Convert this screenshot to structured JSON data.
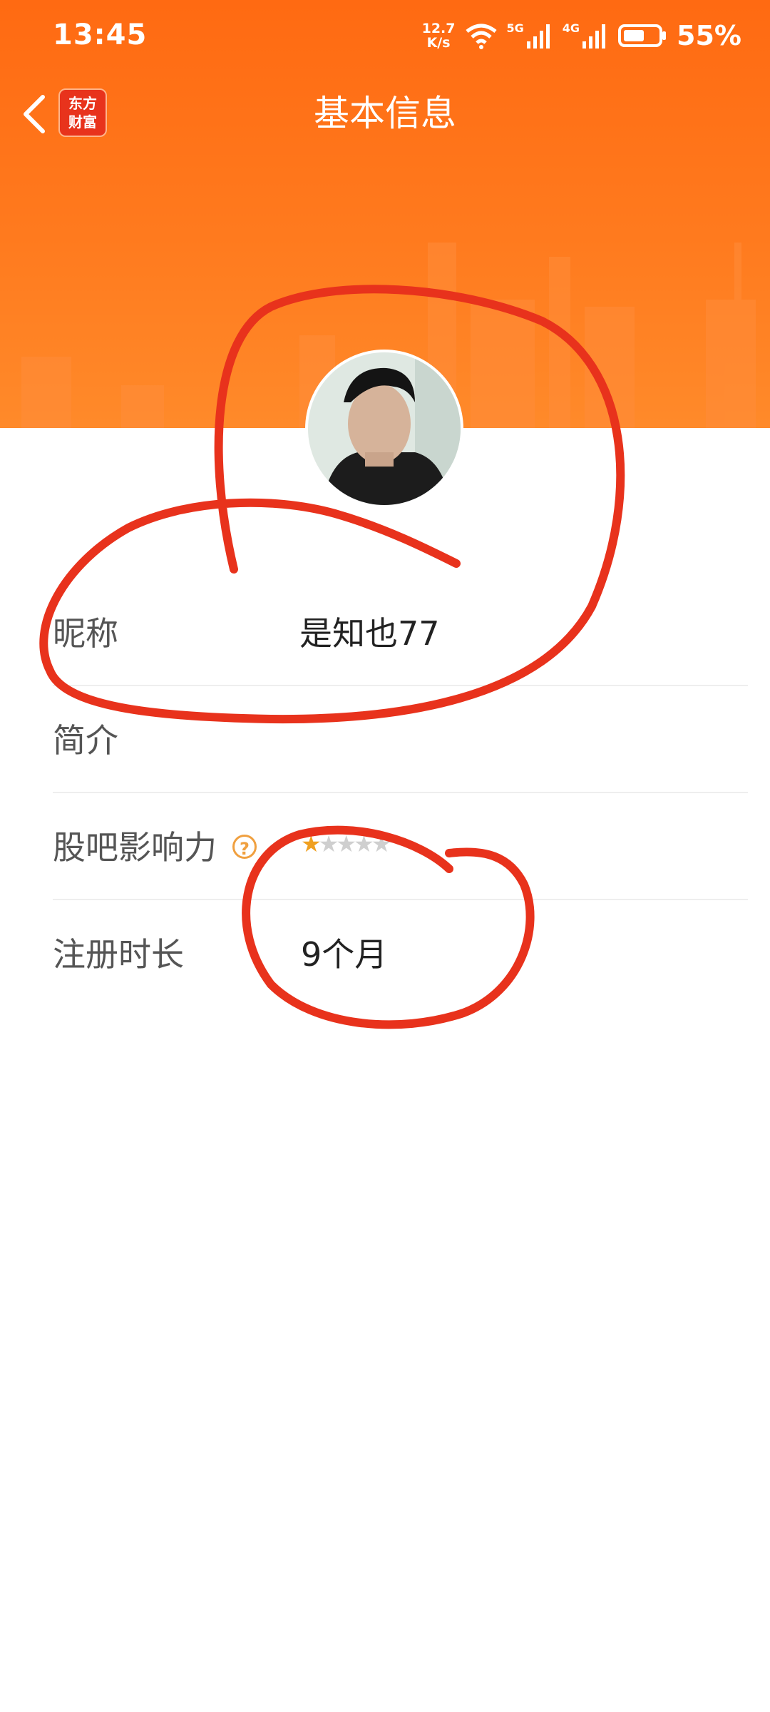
{
  "status_bar": {
    "time": "13:45",
    "net_speed_value": "12.7",
    "net_speed_unit": "K/s",
    "signal_1_label": "5G",
    "signal_2_label": "4G",
    "battery": "55%"
  },
  "nav": {
    "logo_line1": "东方",
    "logo_line2": "财富",
    "title": "基本信息"
  },
  "profile": {
    "rows": [
      {
        "label": "昵称",
        "value": "是知也77"
      },
      {
        "label": "简介",
        "value": ""
      },
      {
        "label": "股吧影响力",
        "help": "?",
        "stars_filled": 1,
        "stars_total": 5
      },
      {
        "label": "注册时长",
        "value": "9个月"
      }
    ]
  },
  "colors": {
    "header": "#ff6a12",
    "annotation": "#e8321c",
    "star_on": "#f0a020"
  }
}
